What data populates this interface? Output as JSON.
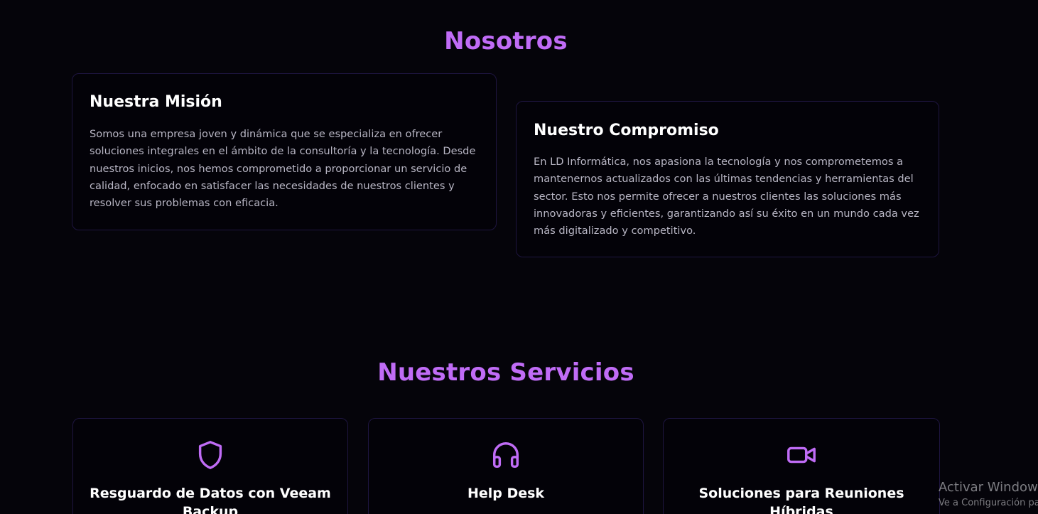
{
  "about": {
    "title": "Nosotros",
    "cards": [
      {
        "title": "Nuestra Misión",
        "text": "Somos una empresa joven y dinámica que se especializa en ofrecer soluciones integrales en el ámbito de la consultoría y la tecnología. Desde nuestros inicios, nos hemos comprometido a proporcionar un servicio de calidad, enfocado en satisfacer las necesidades de nuestros clientes y resolver sus problemas con eficacia."
      },
      {
        "title": "Nuestro Compromiso",
        "text": "En LD Informática, nos apasiona la tecnología y nos comprometemos a mantenernos actualizados con las últimas tendencias y herramientas del sector. Esto nos permite ofrecer a nuestros clientes las soluciones más innovadoras y eficientes, garantizando así su éxito en un mundo cada vez más digitalizado y competitivo."
      }
    ]
  },
  "services": {
    "title": "Nuestros Servicios",
    "items": [
      {
        "icon": "shield-icon",
        "title": "Resguardo de Datos con Veeam Backup"
      },
      {
        "icon": "headphones-icon",
        "title": "Help Desk"
      },
      {
        "icon": "video-camera-icon",
        "title": "Soluciones para Reuniones Híbridas"
      }
    ]
  },
  "watermark": {
    "title": "Activar Windows",
    "subtitle": "Ve a Configuración para activar Windows."
  },
  "colors": {
    "background": "#05040a",
    "accent": "#c06cf6",
    "card_border": "#1e1540",
    "body_text": "#b8b6c4"
  }
}
